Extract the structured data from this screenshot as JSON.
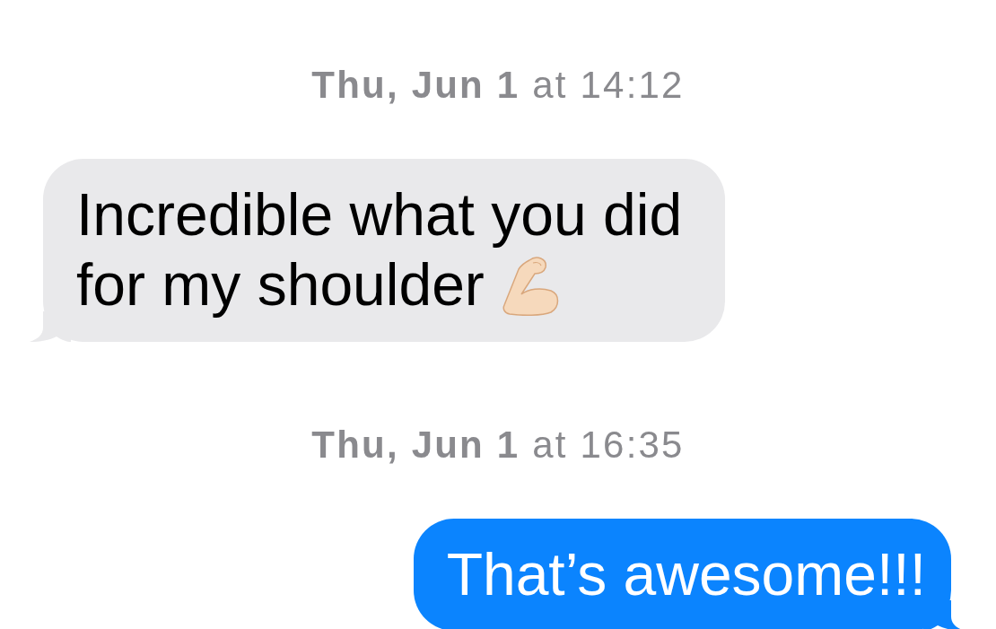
{
  "messages": [
    {
      "kind": "timestamp",
      "text": "**Thu, Jun 1** at 14:12"
    },
    {
      "kind": "incoming",
      "text": "Incredible what you did for my shoulder",
      "trailing_emoji": true
    },
    {
      "kind": "timestamp",
      "text": "**Thu, Jun 1** at 16:35"
    },
    {
      "kind": "outgoing",
      "text": "That’s awesome!!!"
    }
  ]
}
